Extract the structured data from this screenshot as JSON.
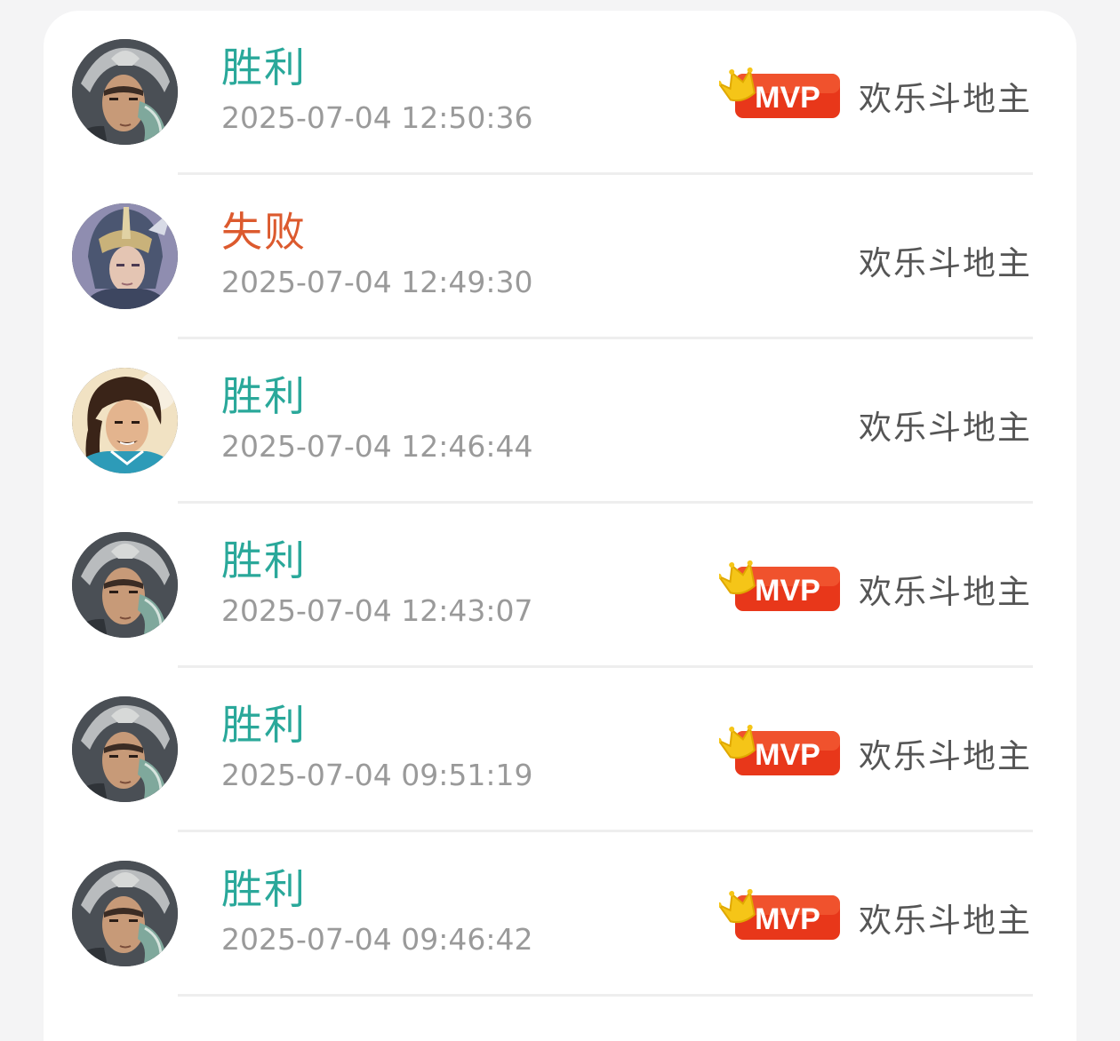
{
  "records": [
    {
      "result": "胜利",
      "outcome": "win",
      "time": "2025-07-04 12:50:36",
      "mode": "欢乐斗地主",
      "mvp": true,
      "mvp_label": "MVP",
      "hero_icon": "armored-warrior-avatar-icon"
    },
    {
      "result": "失败",
      "outcome": "loss",
      "time": "2025-07-04 12:49:30",
      "mode": "欢乐斗地主",
      "mvp": false,
      "hero_icon": "silver-helmet-warrior-avatar-icon"
    },
    {
      "result": "胜利",
      "outcome": "win",
      "time": "2025-07-04 12:46:44",
      "mode": "欢乐斗地主",
      "mvp": false,
      "hero_icon": "long-hair-swordsman-avatar-icon"
    },
    {
      "result": "胜利",
      "outcome": "win",
      "time": "2025-07-04 12:43:07",
      "mode": "欢乐斗地主",
      "mvp": true,
      "mvp_label": "MVP",
      "hero_icon": "armored-warrior-avatar-icon"
    },
    {
      "result": "胜利",
      "outcome": "win",
      "time": "2025-07-04 09:51:19",
      "mode": "欢乐斗地主",
      "mvp": true,
      "mvp_label": "MVP",
      "hero_icon": "armored-warrior-avatar-icon"
    },
    {
      "result": "胜利",
      "outcome": "win",
      "time": "2025-07-04 09:46:42",
      "mode": "欢乐斗地主",
      "mvp": true,
      "mvp_label": "MVP",
      "hero_icon": "armored-warrior-avatar-icon"
    }
  ],
  "colors": {
    "win": "#2aa89a",
    "loss": "#dc5a2e",
    "time": "#9a9a9a",
    "mode": "#555555",
    "mvp_badge": "#e8371a",
    "crown": "#f5c518"
  }
}
